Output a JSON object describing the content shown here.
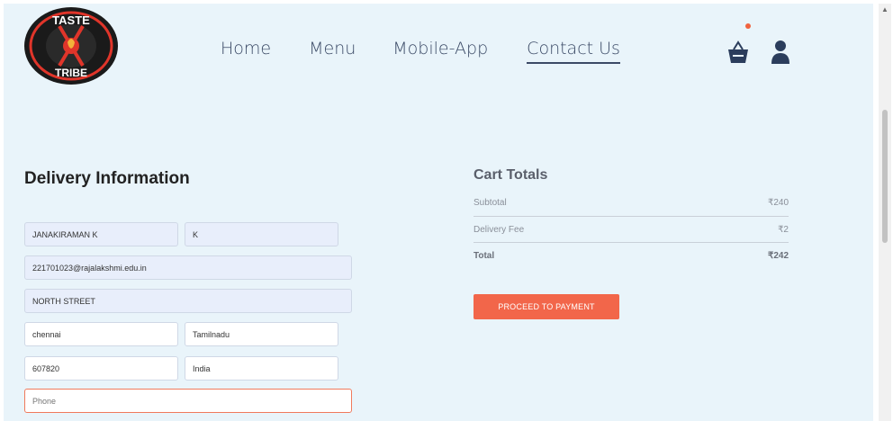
{
  "brand": {
    "logo_text_top": "TASTE",
    "logo_text_bottom": "TRIBE",
    "colors": {
      "dark": "#1a1a1a",
      "accent": "#e0352a",
      "gold": "#f2b23a"
    }
  },
  "nav": {
    "items": [
      {
        "label": "Home",
        "active": false
      },
      {
        "label": "Menu",
        "active": false
      },
      {
        "label": "Mobile-App",
        "active": false
      },
      {
        "label": "Contact Us",
        "active": true
      }
    ],
    "cart_icon": "basket-icon",
    "profile_icon": "user-icon",
    "cart_has_items": true
  },
  "delivery": {
    "title": "Delivery Information",
    "fields": {
      "first_name": "JANAKIRAMAN K",
      "last_name": "K",
      "email": "221701023@rajalakshmi.edu.in",
      "street": "NORTH STREET",
      "city": "chennai",
      "state": "Tamilnadu",
      "zip": "607820",
      "country": "India",
      "phone_placeholder": "Phone"
    }
  },
  "cart": {
    "title": "Cart Totals",
    "rows": [
      {
        "label": "Subtotal",
        "value": "₹240"
      },
      {
        "label": "Delivery Fee",
        "value": "₹2"
      },
      {
        "label": "Total",
        "value": "₹242"
      }
    ],
    "button_label": "PROCEED TO PAYMENT",
    "accent_color": "#f2664a"
  }
}
